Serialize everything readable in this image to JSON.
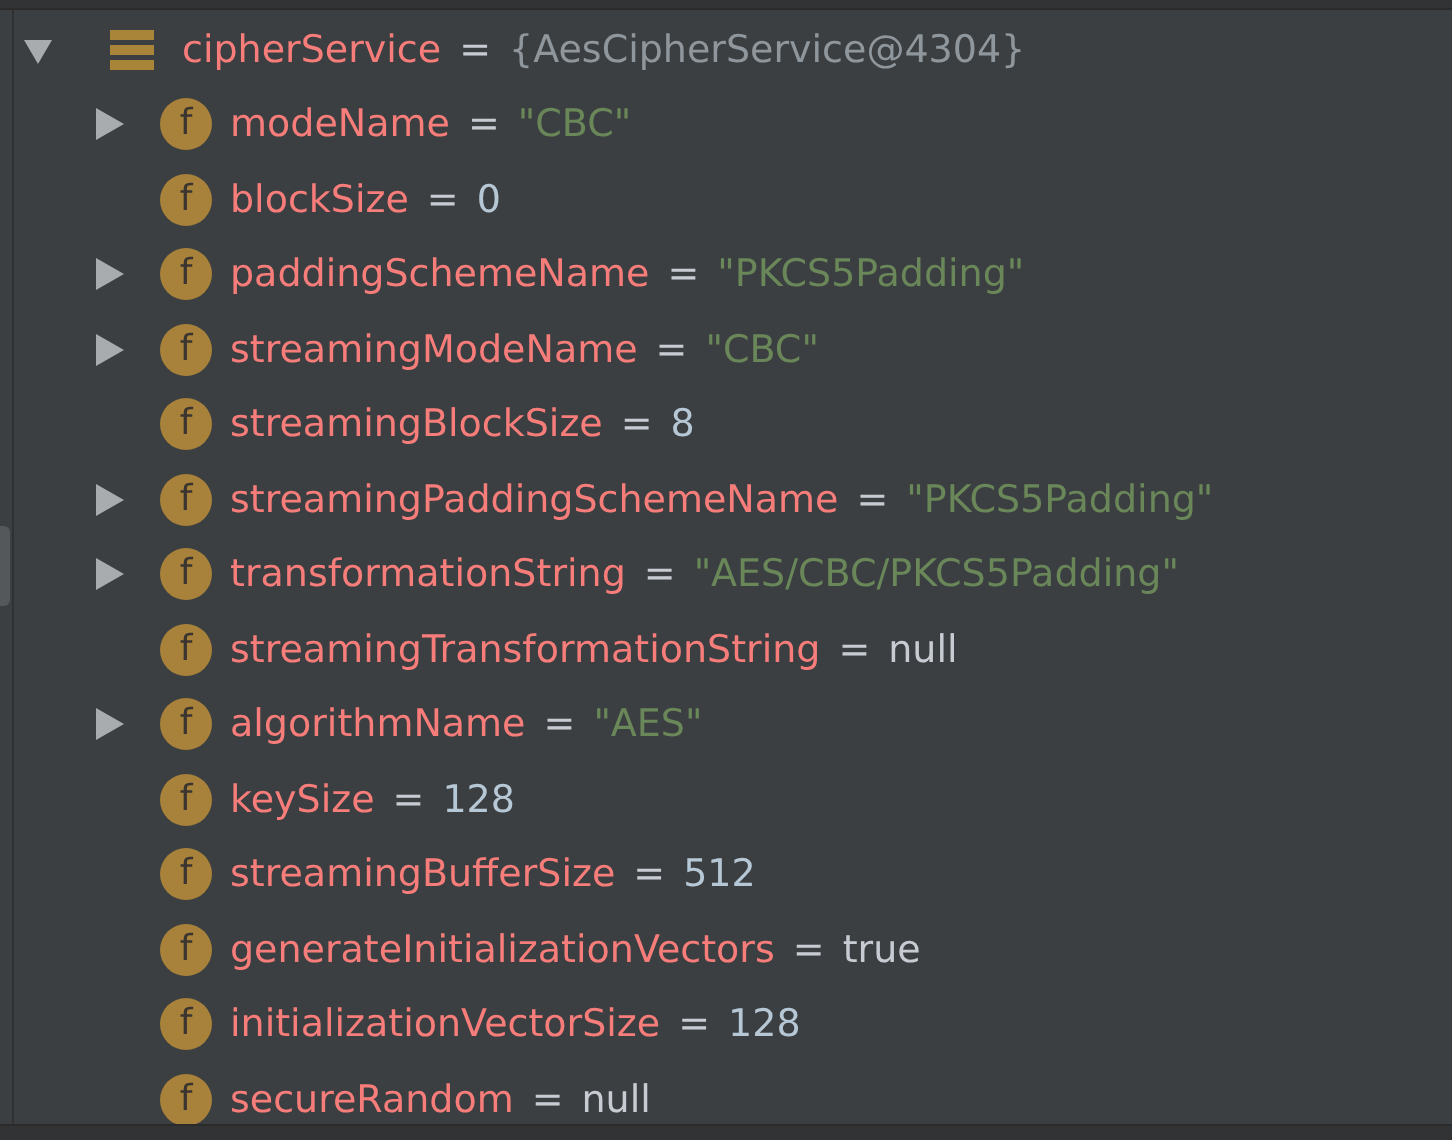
{
  "tree": {
    "name": "cipherService",
    "eq": "=",
    "value": "{AesCipherService@4304}",
    "expanded": true,
    "children": [
      {
        "badge": "f",
        "name": "modeName",
        "eq": "=",
        "value": "\"CBC\"",
        "kind": "string",
        "has_children": true
      },
      {
        "badge": "f",
        "name": "blockSize",
        "eq": "=",
        "value": "0",
        "kind": "number",
        "has_children": false
      },
      {
        "badge": "f",
        "name": "paddingSchemeName",
        "eq": "=",
        "value": "\"PKCS5Padding\"",
        "kind": "string",
        "has_children": true
      },
      {
        "badge": "f",
        "name": "streamingModeName",
        "eq": "=",
        "value": "\"CBC\"",
        "kind": "string",
        "has_children": true
      },
      {
        "badge": "f",
        "name": "streamingBlockSize",
        "eq": "=",
        "value": "8",
        "kind": "number",
        "has_children": false
      },
      {
        "badge": "f",
        "name": "streamingPaddingSchemeName",
        "eq": "=",
        "value": "\"PKCS5Padding\"",
        "kind": "string",
        "has_children": true
      },
      {
        "badge": "f",
        "name": "transformationString",
        "eq": "=",
        "value": "\"AES/CBC/PKCS5Padding\"",
        "kind": "string",
        "has_children": true
      },
      {
        "badge": "f",
        "name": "streamingTransformationString",
        "eq": "=",
        "value": "null",
        "kind": "keyword",
        "has_children": false
      },
      {
        "badge": "f",
        "name": "algorithmName",
        "eq": "=",
        "value": "\"AES\"",
        "kind": "string",
        "has_children": true
      },
      {
        "badge": "f",
        "name": "keySize",
        "eq": "=",
        "value": "128",
        "kind": "number",
        "has_children": false
      },
      {
        "badge": "f",
        "name": "streamingBufferSize",
        "eq": "=",
        "value": "512",
        "kind": "number",
        "has_children": false
      },
      {
        "badge": "f",
        "name": "generateInitializationVectors",
        "eq": "=",
        "value": "true",
        "kind": "keyword",
        "has_children": false
      },
      {
        "badge": "f",
        "name": "initializationVectorSize",
        "eq": "=",
        "value": "128",
        "kind": "number",
        "has_children": false
      },
      {
        "badge": "f",
        "name": "secureRandom",
        "eq": "=",
        "value": "null",
        "kind": "keyword",
        "has_children": false
      }
    ]
  }
}
